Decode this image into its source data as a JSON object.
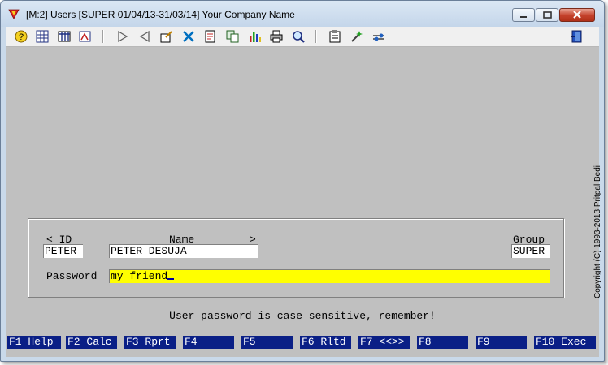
{
  "window": {
    "title": "[M:2]  Users  [SUPER  01/04/13-31/03/14]  Your Company Name"
  },
  "toolbar": {
    "icons": [
      "help-icon",
      "calculator-icon",
      "table-icon",
      "report-icon",
      "next-icon",
      "previous-icon",
      "edit-icon",
      "tools-icon",
      "document-icon",
      "copy-icon",
      "chart-icon",
      "print-icon",
      "search-icon",
      "clipboard-icon",
      "magic-icon",
      "settings-icon",
      "exit-icon"
    ]
  },
  "form": {
    "id_label": "< ID",
    "name_label": "Name",
    "name_arrow": ">",
    "group_label": "Group",
    "id_value": "PETER",
    "name_value": "PETER DESUJA",
    "group_value": "SUPER",
    "password_label": "Password",
    "password_value": "my friend"
  },
  "message": "User password is case sensitive, remember!",
  "copyright": "Copyright (C) 1993-2013  Pritpal Bedi",
  "fkeys": [
    "F1 Help",
    "F2 Calc",
    "F3 Rprt",
    "F4",
    "F5",
    "F6 Rltd",
    "F7 <<>>",
    "F8",
    "F9",
    "F10 Exec"
  ],
  "colors": {
    "fkey_bg": "#0a1f86",
    "password_bg": "#ffff00",
    "client_bg": "#c0c0c0"
  }
}
